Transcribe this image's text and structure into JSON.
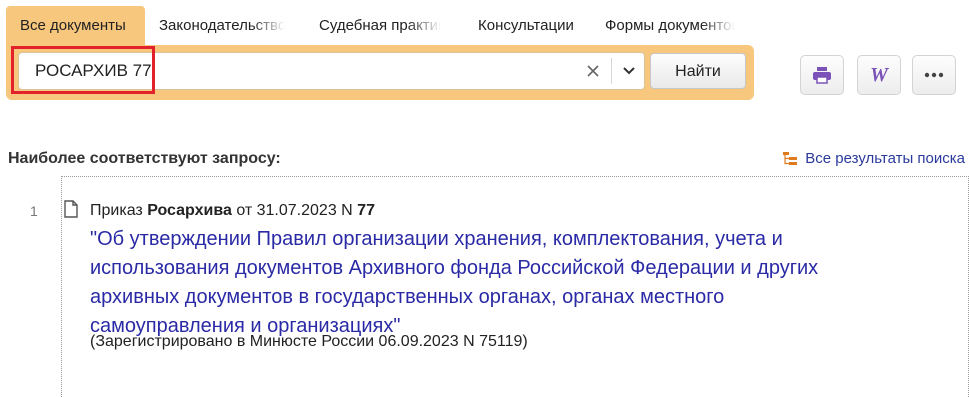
{
  "tabs": [
    {
      "label": "Все документы",
      "active": true
    },
    {
      "label": "Законодательство"
    },
    {
      "label": "Судебная практика"
    },
    {
      "label": "Консультации"
    },
    {
      "label": "Формы документов"
    }
  ],
  "search": {
    "value": "РОСАРХИВ 77",
    "clear_icon": "close-icon",
    "dropdown_icon": "chevron-down-icon",
    "button_label": "Найти"
  },
  "tools": {
    "print_icon": "printer-icon",
    "word_icon": "word-export-icon",
    "word_glyph": "W",
    "more_icon": "more-icon"
  },
  "results": {
    "heading": "Наиболее соответствуют запросу:",
    "all_results_label": "Все результаты поиска",
    "items": [
      {
        "number": "1",
        "type": "Приказ",
        "issuer": "Росархива",
        "date_prefix": "от 31.07.2023 N",
        "doc_number": "77",
        "title": "\"Об утверждении Правил организации хранения, комплектования, учета и использования документов Архивного фонда Российской Федерации и других архивных документов в государственных органах, органах местного самоуправления и организациях\"",
        "registration": "(Зарегистрировано в Минюсте России 06.09.2023 N 75119)"
      }
    ]
  },
  "colors": {
    "accent": "#f7c77d",
    "highlight": "#e3212b",
    "link": "#2a2aa6",
    "tool_icon": "#7b52b8"
  }
}
